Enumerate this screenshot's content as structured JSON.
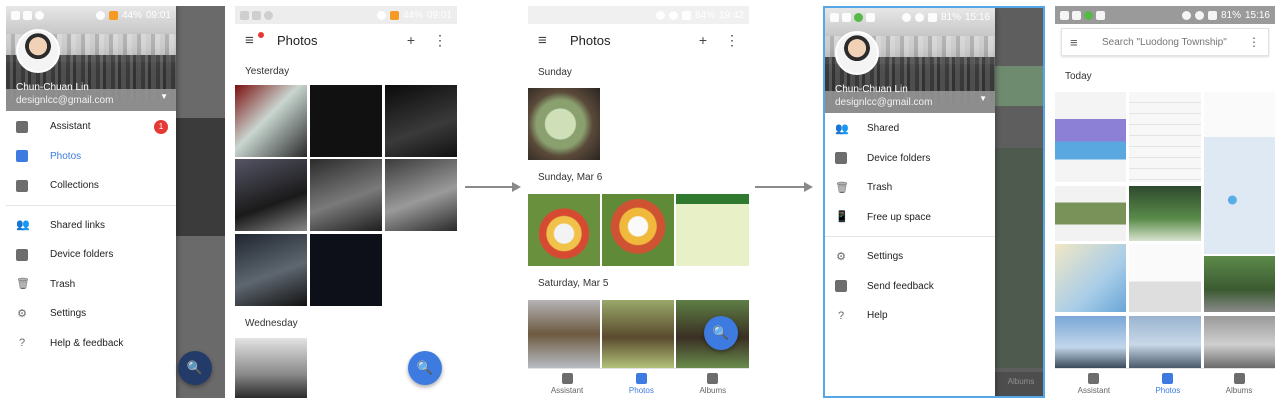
{
  "colors": {
    "accent": "#3d7be0",
    "badge": "#e53935",
    "highlight_border": "#55a7e8"
  },
  "user": {
    "name": "Chun-Chuan Lin",
    "email": "designlcc@gmail.com"
  },
  "screen1": {
    "status": {
      "battery": "44%",
      "time": "09:01"
    },
    "menu": [
      {
        "label": "Assistant",
        "icon": "assistant-icon",
        "badge": "1"
      },
      {
        "label": "Photos",
        "icon": "photos-icon",
        "active": true
      },
      {
        "label": "Collections",
        "icon": "collections-icon"
      },
      {
        "label": "Shared links",
        "icon": "people-icon"
      },
      {
        "label": "Device folders",
        "icon": "folder-icon"
      },
      {
        "label": "Trash",
        "icon": "trash-icon"
      },
      {
        "label": "Settings",
        "icon": "gear-icon"
      },
      {
        "label": "Help & feedback",
        "icon": "help-icon"
      }
    ]
  },
  "screen2": {
    "status": {
      "battery": "44%",
      "time": "09:01"
    },
    "title": "Photos",
    "sections": [
      "Yesterday",
      "Wednesday"
    ]
  },
  "screen3": {
    "status": {
      "battery": "84%",
      "time": "19:42"
    },
    "title": "Photos",
    "sections": [
      "Sunday",
      "Sunday, Mar 6",
      "Saturday, Mar 5"
    ],
    "bottom_nav": [
      "Assistant",
      "Photos",
      "Albums"
    ]
  },
  "screen4": {
    "status": {
      "battery": "81%",
      "time": "15:16"
    },
    "menu": [
      {
        "label": "Shared",
        "icon": "people-icon"
      },
      {
        "label": "Device folders",
        "icon": "folder-icon"
      },
      {
        "label": "Trash",
        "icon": "trash-icon"
      },
      {
        "label": "Free up space",
        "icon": "phone-icon"
      },
      {
        "label": "Settings",
        "icon": "gear-icon"
      },
      {
        "label": "Send feedback",
        "icon": "feedback-icon"
      },
      {
        "label": "Help",
        "icon": "help-icon"
      }
    ],
    "behind_label": "Albums"
  },
  "screen5": {
    "status": {
      "battery": "81%",
      "time": "15:16"
    },
    "search_placeholder": "Search \"Luodong Township\"",
    "section": "Today",
    "bottom_nav": [
      "Assistant",
      "Photos",
      "Albums"
    ]
  }
}
